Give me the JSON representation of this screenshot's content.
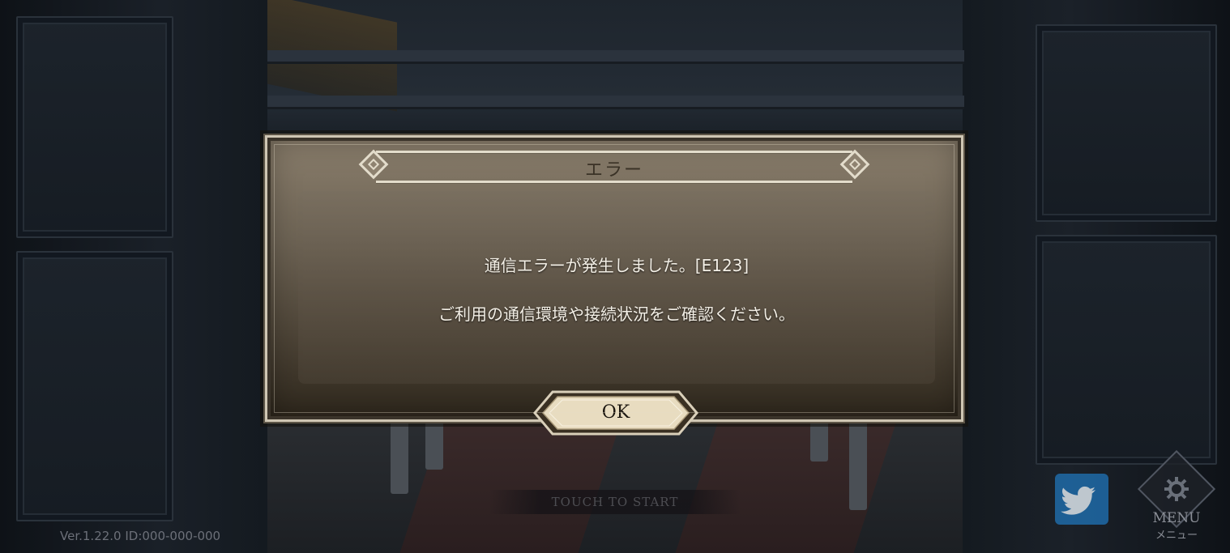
{
  "dialog": {
    "title": "エラー",
    "message_line1": "通信エラーが発生しました。[E123]",
    "message_line2": "ご利用の通信環境や接続状況をご確認ください。",
    "ok_label": "OK"
  },
  "hud": {
    "touch_to_start": "TOUCH TO START",
    "version": "Ver.1.22.0 ID:000-000-000",
    "menu_label": "MENU",
    "menu_sublabel": "メニュー"
  },
  "icons": {
    "twitter": "twitter-bird-icon",
    "menu": "gear-icon"
  },
  "colors": {
    "dialog_border": "#cfc6b3",
    "ok_button_fill": "#e8dcc0",
    "twitter_blue": "#1f6fb0"
  }
}
